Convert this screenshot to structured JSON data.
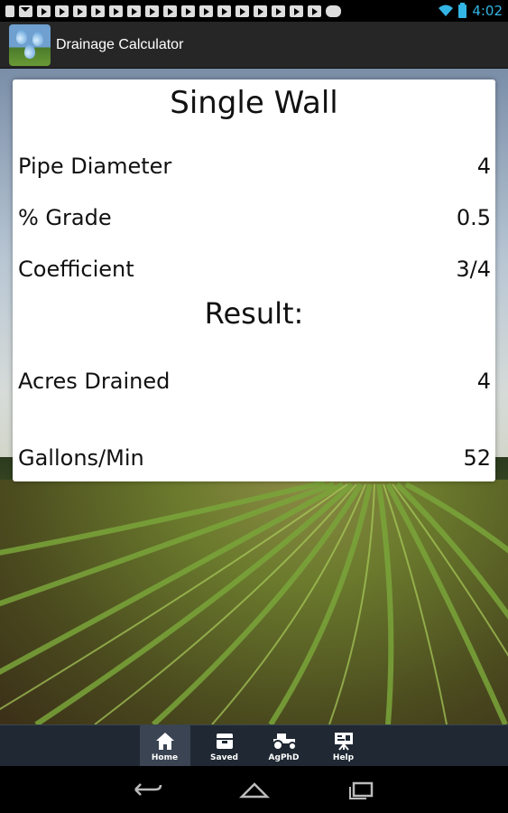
{
  "status_bar": {
    "time": "4:02",
    "icons": [
      "notification-icon",
      "mail-icon",
      "video-icon",
      "video-icon",
      "video-icon",
      "video-icon",
      "video-icon",
      "video-icon",
      "video-icon",
      "video-icon",
      "video-icon",
      "video-icon",
      "video-icon",
      "video-icon",
      "video-icon",
      "video-icon",
      "video-icon",
      "video-icon",
      "android-icon"
    ],
    "accent": "#33b5e5"
  },
  "action_bar": {
    "title": "Drainage Calculator",
    "icon": "water-drops-icon"
  },
  "card": {
    "title": "Single Wall",
    "fields": [
      {
        "label": "Pipe Diameter",
        "value": "4"
      },
      {
        "label": "% Grade",
        "value": "0.5"
      },
      {
        "label": "Coefficient",
        "value": "3/4"
      }
    ],
    "result_title": "Result:",
    "results": [
      {
        "label": "Acres Drained",
        "value": "4"
      },
      {
        "label": "Gallons/Min",
        "value": "52"
      }
    ]
  },
  "tabs": [
    {
      "label": "Home",
      "icon": "home-icon",
      "active": true
    },
    {
      "label": "Saved",
      "icon": "box-icon",
      "active": false
    },
    {
      "label": "AgPhD",
      "icon": "tractor-icon",
      "active": false
    },
    {
      "label": "Help",
      "icon": "presentation-icon",
      "active": false
    }
  ],
  "nav_bar": {
    "buttons": [
      "back-icon",
      "home-icon",
      "recents-icon"
    ]
  }
}
